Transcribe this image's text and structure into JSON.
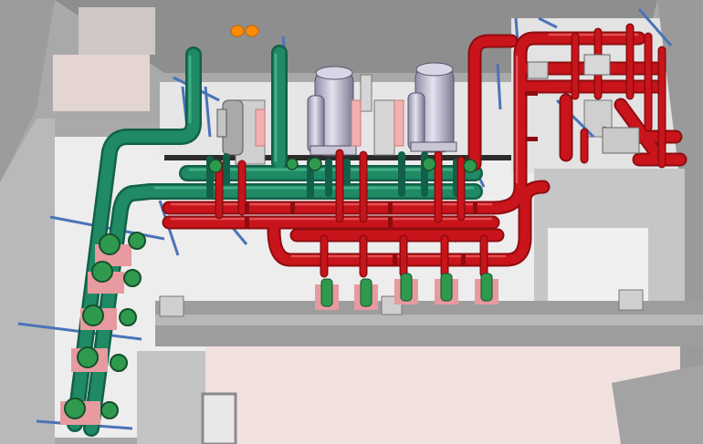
{
  "scene": {
    "subject": "3d-mechanical-room-piping-model",
    "colors": {
      "supply_pipe": "#c8141a",
      "supply_pipe_dark": "#8e0c10",
      "return_pipe": "#1f8a64",
      "return_pipe_dark": "#12604a",
      "pump_body": "#2f9a4e",
      "pump_pad": "#e79aa0",
      "chiller_shell": "#b6b3c8",
      "support_steel": "#4b73b8",
      "floor": "#ededed",
      "wall_top": "#8b8b8b",
      "wall_face": "#b4b4b4",
      "accent_orange": "#ff8c00"
    }
  }
}
